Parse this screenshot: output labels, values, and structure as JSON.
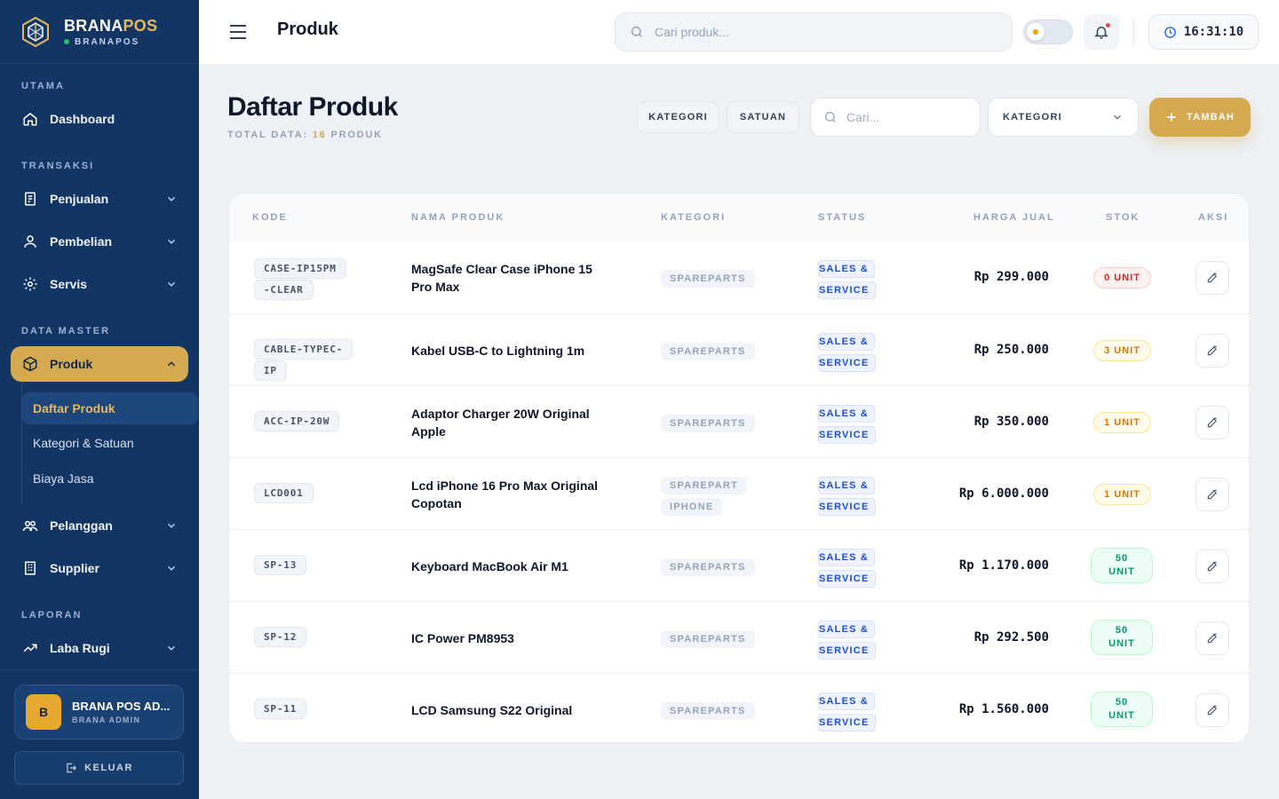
{
  "brand": {
    "name_a": "BRANA",
    "name_b": "POS",
    "sub": "BRANAPOS"
  },
  "sidebar": {
    "sections": [
      "UTAMA",
      "TRANSAKSI",
      "DATA MASTER",
      "LAPORAN"
    ],
    "items": {
      "dashboard": "Dashboard",
      "penjualan": "Penjualan",
      "pembelian": "Pembelian",
      "servis": "Servis",
      "produk": "Produk",
      "pelanggan": "Pelanggan",
      "supplier": "Supplier",
      "labarugi": "Laba Rugi"
    },
    "subitems": [
      "Daftar Produk",
      "Kategori & Satuan",
      "Biaya Jasa"
    ],
    "user": {
      "initial": "B",
      "name": "BRANA POS AD...",
      "role": "BRANA ADMIN"
    },
    "logout": "KELUAR"
  },
  "topbar": {
    "title": "Produk",
    "search_placeholder": "Cari produk...",
    "time": "16:31:10"
  },
  "main": {
    "title": "Daftar Produk",
    "subtitle_prefix": "TOTAL DATA: ",
    "subtitle_count": "16",
    "subtitle_suffix": " PRODUK",
    "btn_kategori": "KATEGORI",
    "btn_satuan": "SATUAN",
    "search_placeholder": "Cari...",
    "select_value": "KATEGORI",
    "add_label": "TAMBAH"
  },
  "table": {
    "headers": {
      "kode": "KODE",
      "nama": "NAMA PRODUK",
      "kategori": "KATEGORI",
      "status": "STATUS",
      "harga": "HARGA JUAL",
      "stok": "STOK",
      "aksi": "AKSI"
    },
    "rows": [
      {
        "kode": "CASE-IP15PM-CLEAR",
        "nama": "MagSafe Clear Case iPhone 15 Pro Max",
        "kategori": "SPAREPARTS",
        "status": "SALES & SERVICE",
        "harga": "Rp 299.000",
        "stok": "0 UNIT",
        "stok_level": "red"
      },
      {
        "kode": "CABLE-TYPEC-IP",
        "nama": "Kabel USB-C to Lightning 1m",
        "kategori": "SPAREPARTS",
        "status": "SALES & SERVICE",
        "harga": "Rp 250.000",
        "stok": "3 UNIT",
        "stok_level": "yellow"
      },
      {
        "kode": "ACC-IP-20W",
        "nama": "Adaptor Charger 20W Original Apple",
        "kategori": "SPAREPARTS",
        "status": "SALES & SERVICE",
        "harga": "Rp 350.000",
        "stok": "1 UNIT",
        "stok_level": "yellow"
      },
      {
        "kode": "LCD001",
        "nama": "Lcd iPhone 16 Pro Max Original Copotan",
        "kategori": "SPAREPART IPHONE",
        "status": "SALES & SERVICE",
        "harga": "Rp 6.000.000",
        "stok": "1 UNIT",
        "stok_level": "yellow"
      },
      {
        "kode": "SP-13",
        "nama": "Keyboard MacBook Air M1",
        "kategori": "SPAREPARTS",
        "status": "SALES & SERVICE",
        "harga": "Rp 1.170.000",
        "stok": "50 UNIT",
        "stok_level": "green"
      },
      {
        "kode": "SP-12",
        "nama": "IC Power PM8953",
        "kategori": "SPAREPARTS",
        "status": "SALES & SERVICE",
        "harga": "Rp 292.500",
        "stok": "50 UNIT",
        "stok_level": "green"
      },
      {
        "kode": "SP-11",
        "nama": "LCD Samsung S22 Original",
        "kategori": "SPAREPARTS",
        "status": "SALES & SERVICE",
        "harga": "Rp 1.560.000",
        "stok": "50 UNIT",
        "stok_level": "green"
      }
    ]
  },
  "colors": {
    "sidebar_bg": "#123564",
    "accent": "#d4a94f",
    "page_bg": "#eef2f7"
  }
}
